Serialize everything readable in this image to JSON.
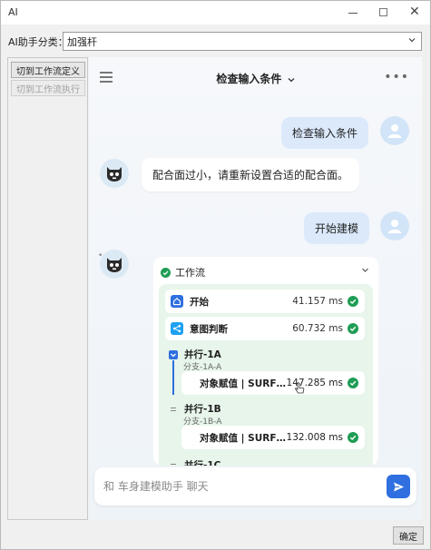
{
  "window": {
    "title": "AI"
  },
  "category": {
    "label": "AI助手分类：",
    "value": "加强杆"
  },
  "left_panel": {
    "btn_workflow_def": "切到工作流定义",
    "btn_workflow_exec": "切到工作流执行"
  },
  "chat": {
    "title": "检查输入条件",
    "title_chevron": "chevron-down-icon",
    "messages": [
      {
        "role": "user",
        "text": "检查输入条件"
      },
      {
        "role": "bot",
        "text": "配合面过小，请重新设置合适的配合面。"
      },
      {
        "role": "user",
        "text": "开始建模"
      }
    ],
    "workflow": {
      "title": "工作流",
      "steps": [
        {
          "name": "开始",
          "time": "41.157 ms",
          "icon": "home-icon",
          "color": "#2f6fe0"
        },
        {
          "name": "意图判断",
          "time": "60.732 ms",
          "icon": "share-icon",
          "color": "#1da1f2"
        }
      ],
      "branches": [
        {
          "name": "并行-1A",
          "sub_label": "分支-1A-A",
          "step_name": "对象赋值 | SURF…",
          "step_time": "147.285 ms"
        },
        {
          "name": "并行-1B",
          "sub_label": "分支-1B-A",
          "step_name": "对象赋值 | SURF…",
          "step_time": "132.008 ms"
        },
        {
          "name": "并行-1C"
        }
      ]
    },
    "input_placeholder": "和 车身建模助手 聊天"
  },
  "footer": {
    "ok_label": "确定"
  },
  "colors": {
    "accent": "#2f6fe0",
    "success": "#1f9d55",
    "user_bubble": "#dbe9fb",
    "workflow_bg": "#e7f5ea"
  }
}
